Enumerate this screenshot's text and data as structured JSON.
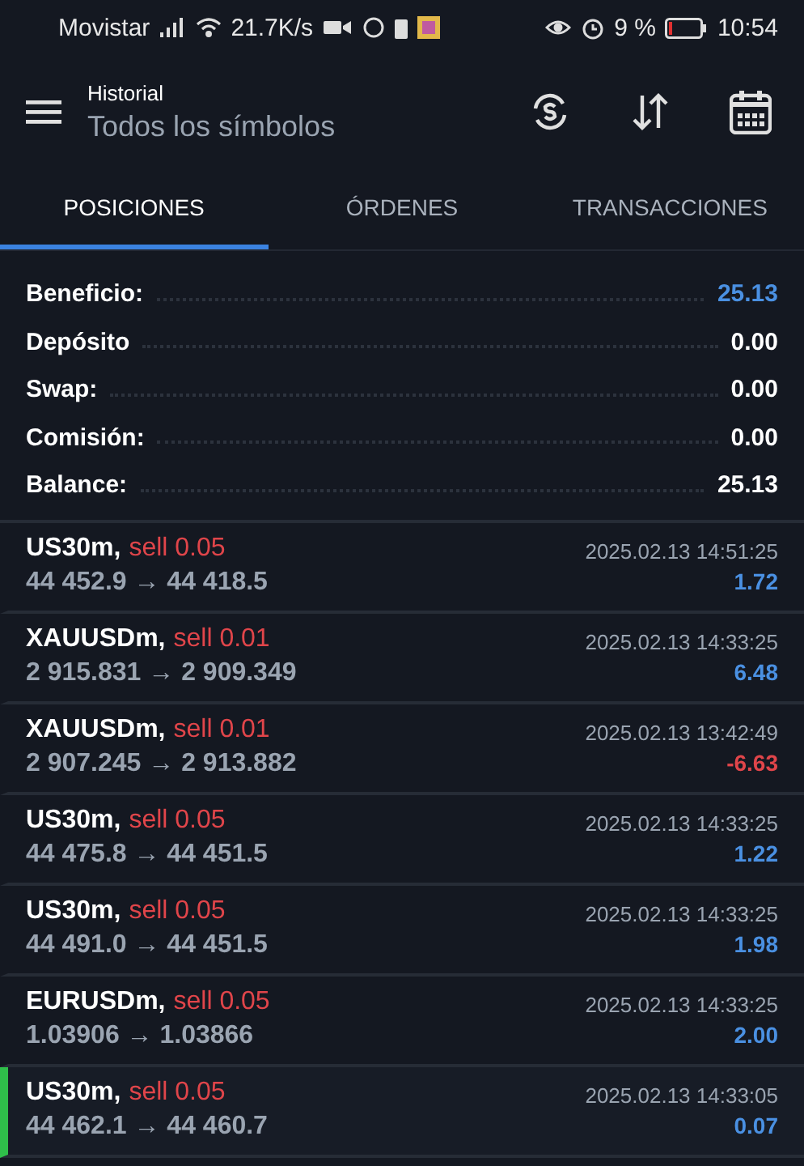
{
  "status_bar": {
    "carrier": "Movistar",
    "speed": "21.7K/s",
    "battery": "9 %",
    "time": "10:54"
  },
  "header": {
    "title": "Historial",
    "subtitle": "Todos los símbolos"
  },
  "tabs": [
    {
      "label": "POSICIONES",
      "selected": true
    },
    {
      "label": "ÓRDENES",
      "selected": false
    },
    {
      "label": "TRANSACCIONES",
      "selected": false
    }
  ],
  "summary": [
    {
      "label": "Beneficio:",
      "value": "25.13",
      "accent": true
    },
    {
      "label": "Depósito",
      "value": "0.00",
      "accent": false
    },
    {
      "label": "Swap:",
      "value": "0.00",
      "accent": false
    },
    {
      "label": "Comisión:",
      "value": "0.00",
      "accent": false
    },
    {
      "label": "Balance:",
      "value": "25.13",
      "accent": false
    }
  ],
  "positions": [
    {
      "symbol": "US30m,",
      "side": "sell 0.05",
      "prices": "44 452.9 → 44 418.5",
      "time": "2025.02.13 14:51:25",
      "profit": "1.72",
      "loss": false,
      "highlighted": false
    },
    {
      "symbol": "XAUUSDm,",
      "side": "sell 0.01",
      "prices": "2 915.831 → 2 909.349",
      "time": "2025.02.13 14:33:25",
      "profit": "6.48",
      "loss": false,
      "highlighted": false
    },
    {
      "symbol": "XAUUSDm,",
      "side": "sell 0.01",
      "prices": "2 907.245 → 2 913.882",
      "time": "2025.02.13 13:42:49",
      "profit": "-6.63",
      "loss": true,
      "highlighted": false
    },
    {
      "symbol": "US30m,",
      "side": "sell 0.05",
      "prices": "44 475.8 → 44 451.5",
      "time": "2025.02.13 14:33:25",
      "profit": "1.22",
      "loss": false,
      "highlighted": false
    },
    {
      "symbol": "US30m,",
      "side": "sell 0.05",
      "prices": "44 491.0 → 44 451.5",
      "time": "2025.02.13 14:33:25",
      "profit": "1.98",
      "loss": false,
      "highlighted": false
    },
    {
      "symbol": "EURUSDm,",
      "side": "sell 0.05",
      "prices": "1.03906 → 1.03866",
      "time": "2025.02.13 14:33:25",
      "profit": "2.00",
      "loss": false,
      "highlighted": false
    },
    {
      "symbol": "US30m,",
      "side": "sell 0.05",
      "prices": "44 462.1 → 44 460.7",
      "time": "2025.02.13 14:33:05",
      "profit": "0.07",
      "loss": false,
      "highlighted": true
    }
  ]
}
